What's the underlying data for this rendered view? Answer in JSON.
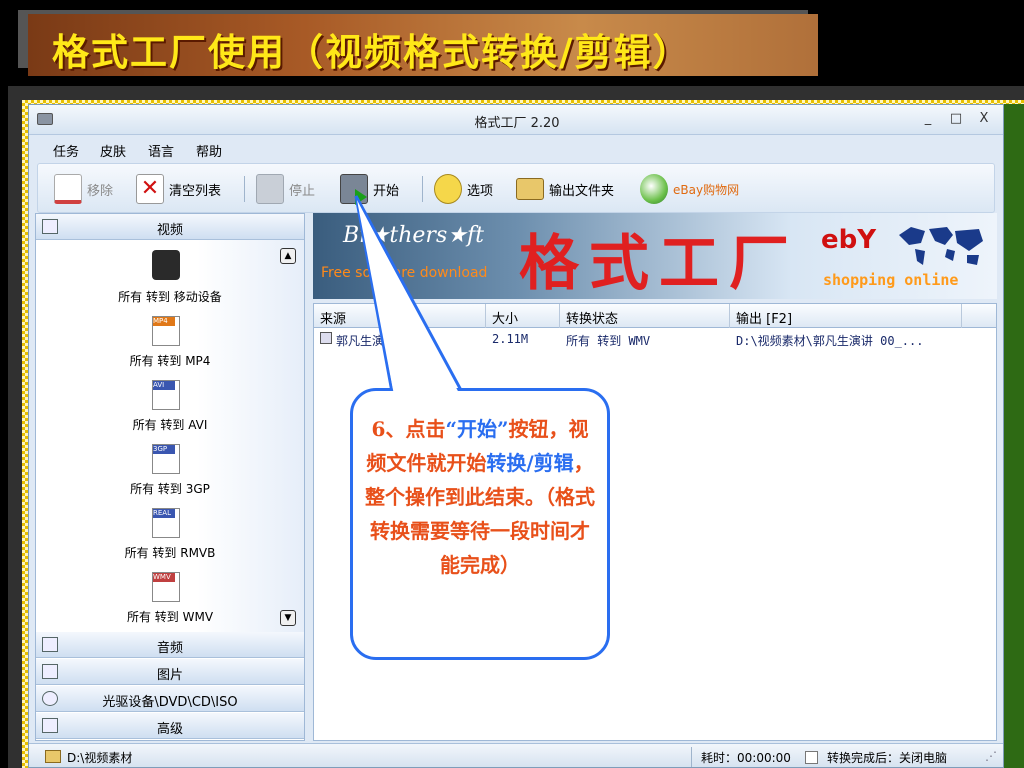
{
  "slide": {
    "title": "格式工厂使用（视频格式转换/剪辑）"
  },
  "window": {
    "title": "格式工厂 2.20",
    "controls": [
      "_",
      "□",
      "X"
    ]
  },
  "menu": [
    "任务",
    "皮肤",
    "语言",
    "帮助"
  ],
  "toolbar": {
    "remove": "移除",
    "clear": "清空列表",
    "stop": "停止",
    "start": "开始",
    "options": "选项",
    "output_folder": "输出文件夹",
    "ebay": "eBay购物网"
  },
  "categories": {
    "video": "视频",
    "audio": "音频",
    "image": "图片",
    "rom": "光驱设备\\DVD\\CD\\ISO",
    "advanced": "高级"
  },
  "video_items": [
    {
      "label": "所有 转到 移动设备",
      "badge": ""
    },
    {
      "label": "所有 转到 MP4",
      "badge": "MP4"
    },
    {
      "label": "所有 转到 AVI",
      "badge": "AVI"
    },
    {
      "label": "所有 转到 3GP",
      "badge": "3GP"
    },
    {
      "label": "所有 转到 RMVB",
      "badge": "REAL"
    },
    {
      "label": "所有 转到 WMV",
      "badge": "WMV"
    }
  ],
  "banner": {
    "brothersoft": "Br★thers★ft",
    "brothersoft_sub": "Free software download",
    "factory": "格式工厂",
    "ebay": "ebY",
    "shopping": "shopping online"
  },
  "table": {
    "headers": [
      "来源",
      "大小",
      "转换状态",
      "输出 [F2]"
    ],
    "rows": [
      {
        "source": "郭凡生演讲.flv",
        "size": "2.11M",
        "status": "所有 转到 WMV",
        "output": "D:\\视频素材\\郭凡生演讲 00_..."
      }
    ]
  },
  "statusbar": {
    "folder": "D:\\视频素材",
    "elapsed": "耗时：00:00:00",
    "after_done": "转换完成后：关闭电脑"
  },
  "callout": {
    "p1": "6、点击",
    "p2": "“开始”",
    "p3": "按钮，视频文件就开始",
    "p4": "转换/剪辑",
    "p5": "，整个操作到此结束。（格式转换需要等待一段时间才能完成）"
  }
}
